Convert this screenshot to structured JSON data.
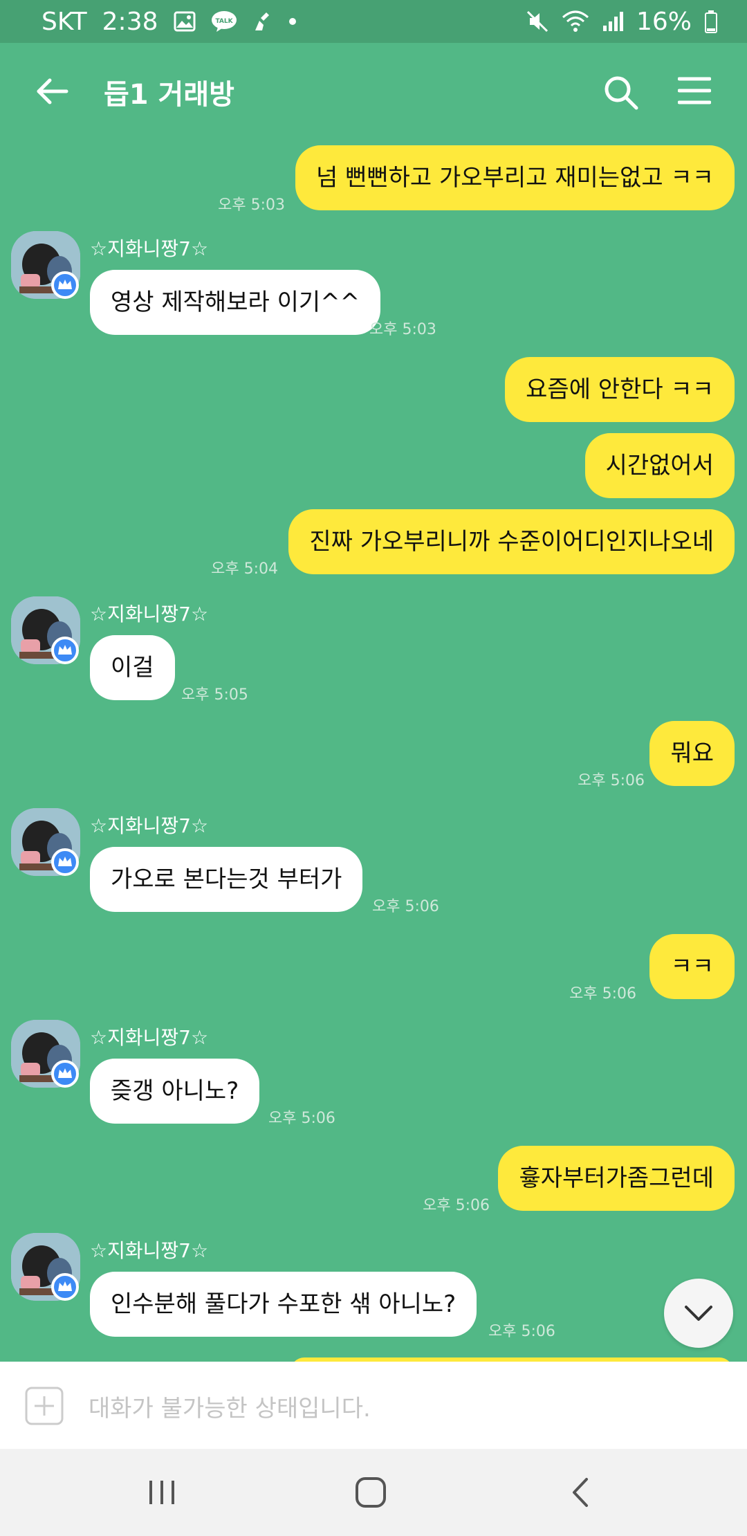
{
  "status_bar": {
    "carrier": "SKT",
    "time": "2:38",
    "battery": "16%",
    "icons": [
      "image-icon",
      "talk-icon",
      "broom-icon",
      "dot-icon",
      "mute-icon",
      "wifi-icon",
      "signal-icon",
      "battery-icon"
    ],
    "talk_label": "TALK"
  },
  "header": {
    "title": "듭1 거래방",
    "icons": [
      "back-arrow-icon",
      "search-icon",
      "menu-icon"
    ]
  },
  "chat": {
    "sender_name": "☆지화니짱7☆",
    "messages": [
      {
        "from": "me",
        "text": "넘 뻔뻔하고 가오부리고 재미는없고 ㅋㅋ",
        "time": "오후 5:03"
      },
      {
        "from": "them",
        "text": "영상 제작해보라 이기^^",
        "time": "오후 5:03"
      },
      {
        "from": "me",
        "text": "요즘에 안한다 ㅋㅋ",
        "time": ""
      },
      {
        "from": "me",
        "text": "시간없어서",
        "time": ""
      },
      {
        "from": "me",
        "text": "진짜 가오부리니까 수준이어디인지나오네",
        "time": "오후 5:04"
      },
      {
        "from": "them",
        "text": "이걸",
        "time": "오후 5:05"
      },
      {
        "from": "me",
        "text": "뭐요",
        "time": "오후 5:06"
      },
      {
        "from": "them",
        "text": "가오로 본다는것 부터가",
        "time": "오후 5:06"
      },
      {
        "from": "me",
        "text": "ㅋㅋ",
        "time": "오후 5:06"
      },
      {
        "from": "them",
        "text": "즞갱 아니노?",
        "time": "오후 5:06"
      },
      {
        "from": "me",
        "text": "흏자부터가좀그런데",
        "time": "오후 5:06"
      },
      {
        "from": "them",
        "text": "인수분해 풀다가 수포한 샊 아니노?",
        "time": "오후 5:06"
      }
    ]
  },
  "input_bar": {
    "placeholder": "대화가 불가능한 상태입니다."
  },
  "colors": {
    "chat_background": "#52b886",
    "status_bar": "#47a173",
    "my_bubble": "#fee93c",
    "their_bubble": "#ffffff",
    "badge": "#3d8af5"
  }
}
